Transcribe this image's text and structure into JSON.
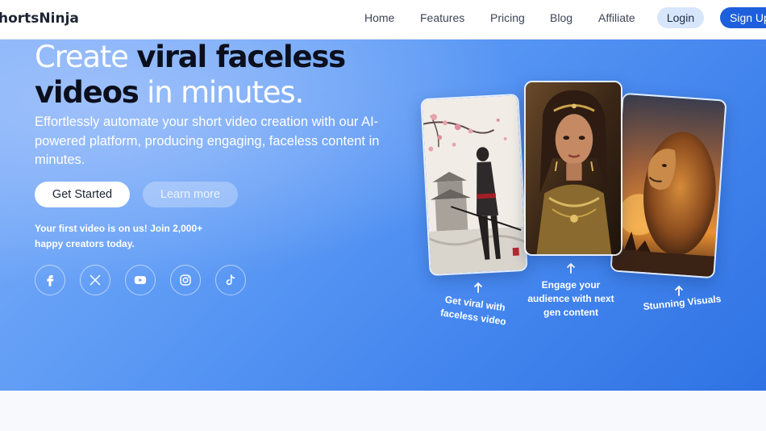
{
  "nav": {
    "logo": "hortsNinja",
    "links": [
      "Home",
      "Features",
      "Pricing",
      "Blog",
      "Affiliate"
    ],
    "login": "Login",
    "signup": "Sign Up"
  },
  "hero": {
    "headline_line1_light": "Create ",
    "headline_line1_dark": "viral faceless",
    "headline_line2_dark": "videos",
    "headline_line2_light": " in minutes.",
    "subtext": "Effortlessly automate your short video creation with our AI-powered platform, producing engaging, faceless content in minutes.",
    "cta_primary": "Get Started",
    "cta_secondary": "Learn more",
    "promo": "Your first video is on us! Join 2,000+ happy creators today.",
    "socials": [
      "facebook-icon",
      "x-icon",
      "youtube-icon",
      "instagram-icon",
      "tiktok-icon"
    ]
  },
  "showcase": {
    "captions": [
      "Get viral with faceless video",
      "Engage your audience with next gen content",
      "Stunning Visuals"
    ],
    "images": [
      "samurai-warrior-image",
      "warrior-woman-image",
      "lion-sunset-image"
    ]
  },
  "colors": {
    "primary": "#1e5fdc",
    "hero_start": "#7fb0f8",
    "hero_end": "#2f72e3",
    "login_bg": "#d7e6fb"
  }
}
